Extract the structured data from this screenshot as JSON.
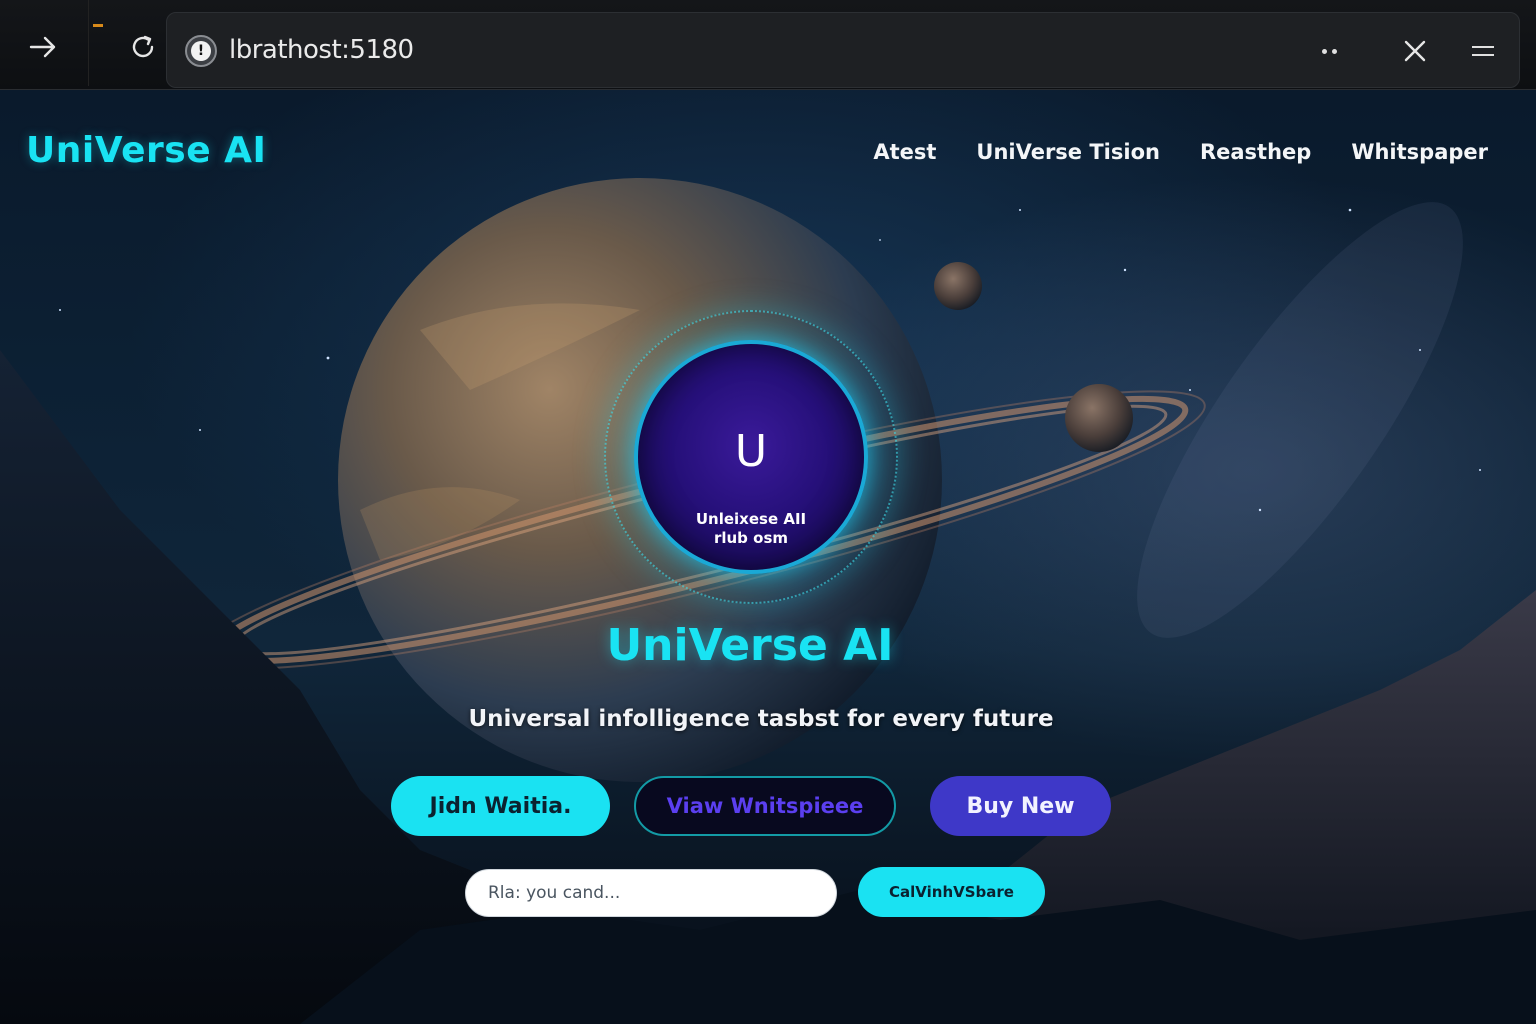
{
  "browser": {
    "url": "lbrathost:5180",
    "icons": {
      "back": "arrow-right-icon",
      "reload": "reload-icon",
      "site_info": "info-icon",
      "more": "more-dots-icon",
      "close": "close-icon",
      "menu": "menu-icon"
    },
    "site_info_glyph": "!"
  },
  "header": {
    "brand": "UniVerse AI",
    "nav": [
      "Atest",
      "UniVerse Tision",
      "Reasthep",
      "Whitspaper"
    ]
  },
  "core": {
    "letter": "U",
    "line1": "Unleixese AII",
    "line2": "rlub osm"
  },
  "hero": {
    "title": "UniVerse AI",
    "tagline": "Universal infolligence tasbst for every future"
  },
  "buttons": {
    "join": "Jidn Waitia.",
    "view": "Viaw Wnitspieee",
    "buy": "Buy New"
  },
  "search": {
    "placeholder": "Rla: you cand..."
  },
  "small_button": "CalVinhVSbare",
  "colors": {
    "accent": "#19e3f3",
    "indigo": "#3e38c8",
    "core": "#26107a"
  }
}
